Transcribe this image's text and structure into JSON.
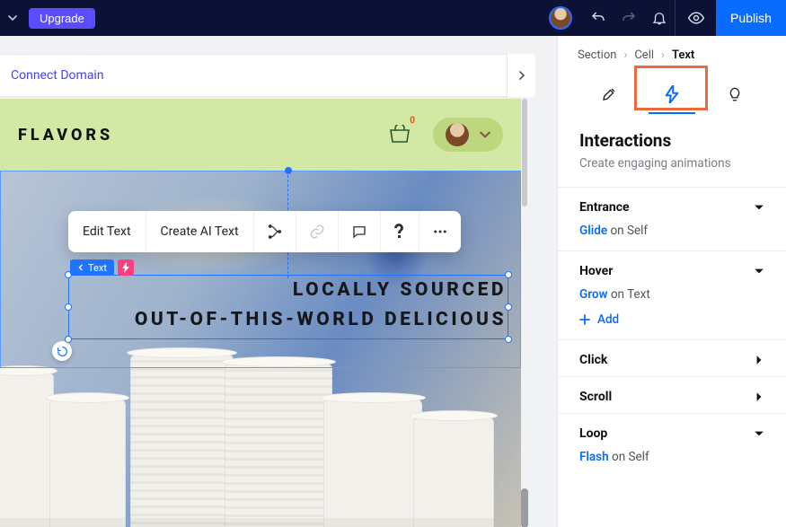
{
  "topbar": {
    "upgrade_label": "Upgrade",
    "publish_label": "Publish"
  },
  "domain_bar": {
    "connect_label": "Connect Domain"
  },
  "site": {
    "brand": "FLAVORS",
    "cart_count": "0",
    "hero_line1": "LOCALLY SOURCED",
    "hero_line2": "OUT-OF-THIS-WORLD DELICIOUS"
  },
  "context_toolbar": {
    "edit_text": "Edit Text",
    "create_ai": "Create AI Text"
  },
  "selection": {
    "chip_label": "Text"
  },
  "breadcrumbs": {
    "a": "Section",
    "b": "Cell",
    "c": "Text"
  },
  "panel": {
    "title": "Interactions",
    "subtitle": "Create engaging animations"
  },
  "interactions": {
    "entrance": {
      "title": "Entrance",
      "anim": "Glide",
      "target": " on Self"
    },
    "hover": {
      "title": "Hover",
      "anim": "Grow",
      "target": " on Text",
      "add_label": "Add"
    },
    "click": {
      "title": "Click"
    },
    "scroll": {
      "title": "Scroll"
    },
    "loop": {
      "title": "Loop",
      "anim": "Flash",
      "target": " on Self"
    }
  }
}
